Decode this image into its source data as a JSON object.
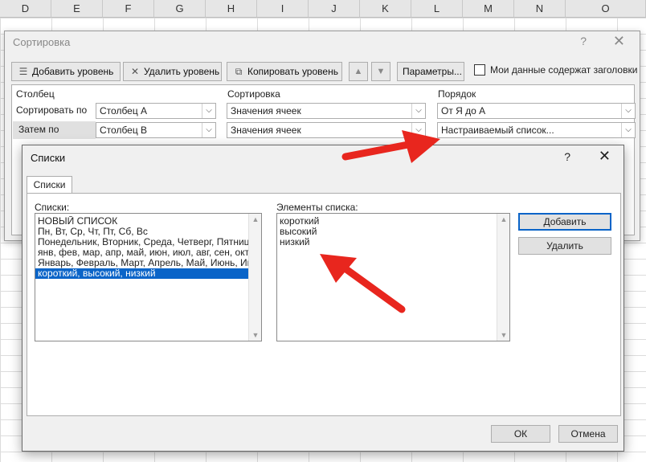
{
  "sheet": {
    "columns": [
      "D",
      "E",
      "F",
      "G",
      "H",
      "I",
      "J",
      "K",
      "L",
      "M",
      "N",
      "O"
    ]
  },
  "sort_dialog": {
    "title": "Сортировка",
    "help": "?",
    "close": "✕",
    "toolbar": {
      "add_level": "Добавить уровень",
      "delete_level": "Удалить уровень",
      "copy_level": "Копировать уровень",
      "move_up": "▲",
      "move_down": "▼",
      "options": "Параметры...",
      "has_headers_label": "Мои данные содержат заголовки"
    },
    "headers": {
      "column": "Столбец",
      "sort_on": "Сортировка",
      "order": "Порядок"
    },
    "rows": [
      {
        "label": "Сортировать по",
        "column": "Столбец A",
        "sort_on": "Значения ячеек",
        "order": "От Я до А"
      },
      {
        "label": "Затем по",
        "column": "Столбец B",
        "sort_on": "Значения ячеек",
        "order": "Настраиваемый список..."
      }
    ]
  },
  "lists_dialog": {
    "title": "Списки",
    "help": "?",
    "close": "✕",
    "tab": "Списки",
    "lists_label": "Списки:",
    "entries_label": "Элементы списка:",
    "lists": [
      "НОВЫЙ СПИСОК",
      "Пн, Вт, Ср, Чт, Пт, Сб, Вс",
      "Понедельник, Вторник, Среда, Четверг, Пятница, Суббота, Воскресенье",
      "янв, фев, мар, апр, май, июн, июл, авг, сен, окт, ноя, дек",
      "Январь, Февраль, Март, Апрель, Май, Июнь, Июль, Август, Сентябрь, Октябрь, Ноябрь, Декабрь",
      "короткий, высокий, низкий"
    ],
    "selected_index": 5,
    "entries": [
      "короткий",
      "высокий",
      "низкий"
    ],
    "add_button": "Добавить",
    "delete_button": "Удалить",
    "ok_button": "ОК",
    "cancel_button": "Отмена"
  },
  "colors": {
    "selection": "#0a64c8",
    "annotation_arrow": "#e8261e"
  }
}
